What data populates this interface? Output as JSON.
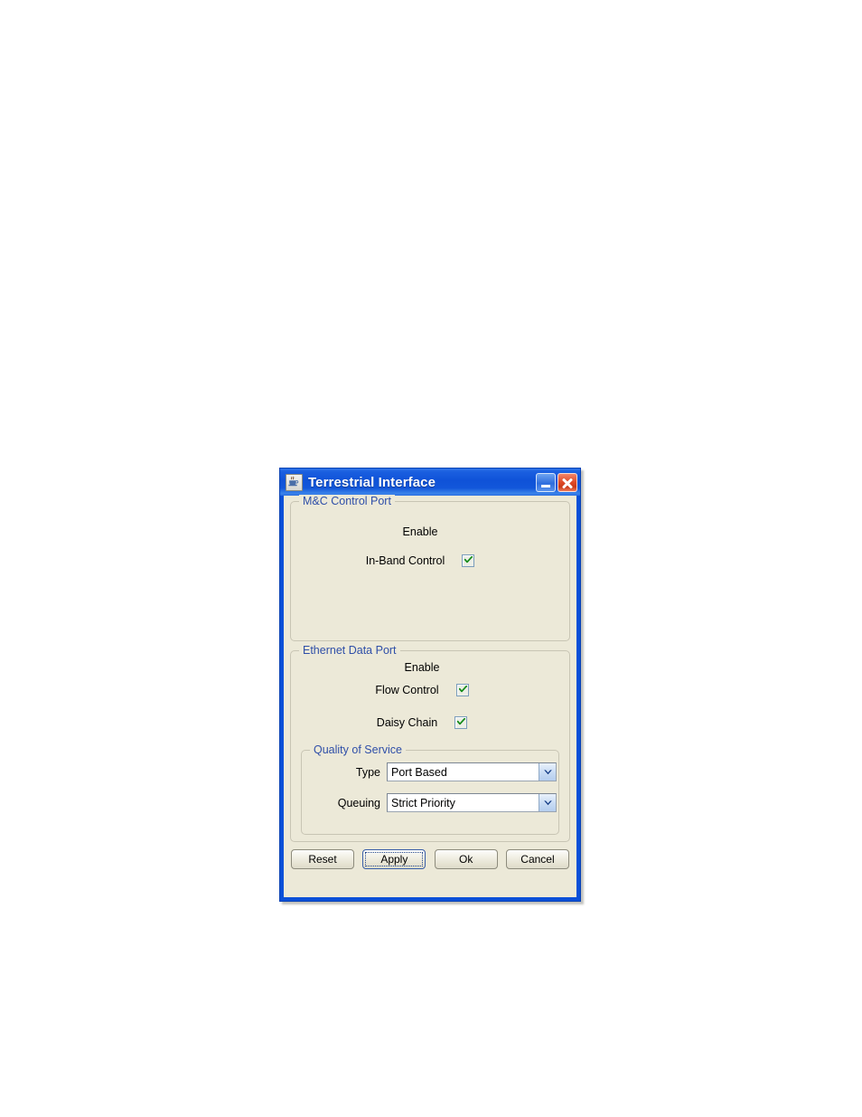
{
  "window": {
    "title": "Terrestrial Interface",
    "icon": "java-coffee-cup-icon",
    "minimize_label": "Minimize",
    "close_label": "Close",
    "titlebar_color": "#0f52d8",
    "client_color": "#ece9d8",
    "panel_title_color": "#2f4fa8"
  },
  "mc_control_port": {
    "title": "M&C Control Port",
    "enable_header": "Enable",
    "rows": [
      {
        "label": "In-Band Control",
        "checked": true
      }
    ]
  },
  "ethernet_data_port": {
    "title": "Ethernet Data Port",
    "enable_header": "Enable",
    "rows": [
      {
        "label": "Flow Control",
        "checked": true
      },
      {
        "label": "Daisy Chain",
        "checked": true
      }
    ],
    "quality_of_service": {
      "title": "Quality of Service",
      "fields": [
        {
          "label": "Type",
          "value": "Port Based"
        },
        {
          "label": "Queuing",
          "value": "Strict Priority"
        }
      ]
    }
  },
  "buttons": {
    "reset": "Reset",
    "apply": "Apply",
    "ok": "Ok",
    "cancel": "Cancel",
    "focused": "Apply"
  }
}
